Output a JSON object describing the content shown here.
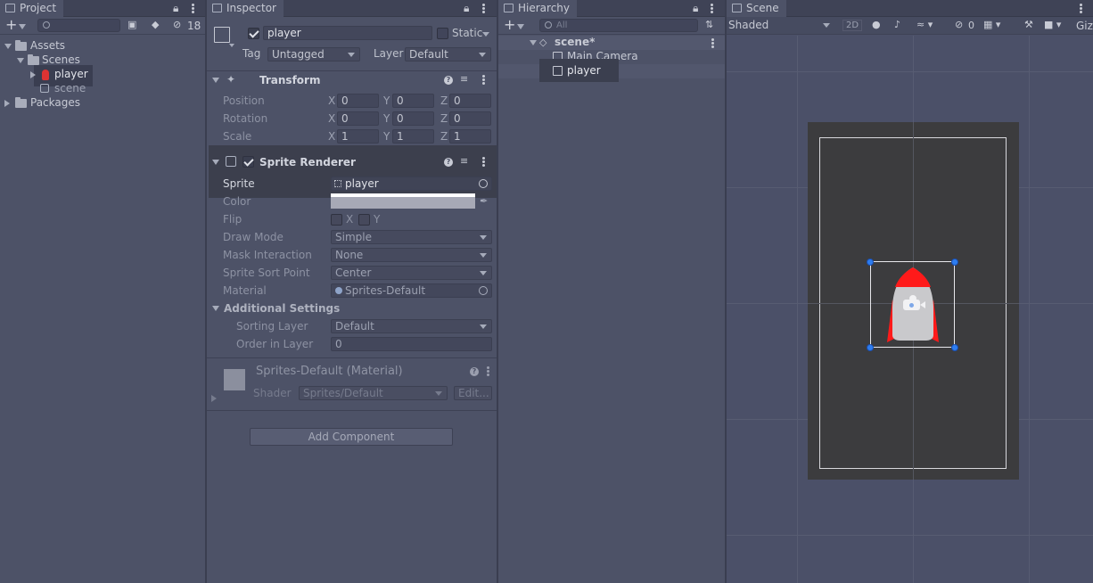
{
  "project": {
    "tab_label": "Project",
    "hidden_count": "18",
    "tree": {
      "assets": "Assets",
      "scenes": "Scenes",
      "player": "player",
      "scene": "scene",
      "packages": "Packages"
    }
  },
  "inspector": {
    "tab_label": "Inspector",
    "object_name": "player",
    "static_label": "Static",
    "tag_label": "Tag",
    "tag_value": "Untagged",
    "layer_label": "Layer",
    "layer_value": "Default",
    "transform": {
      "title": "Transform",
      "position_label": "Position",
      "rotation_label": "Rotation",
      "scale_label": "Scale",
      "position": {
        "x": "0",
        "y": "0",
        "z": "0"
      },
      "rotation": {
        "x": "0",
        "y": "0",
        "z": "0"
      },
      "scale": {
        "x": "1",
        "y": "1",
        "z": "1"
      },
      "axis_x": "X",
      "axis_y": "Y",
      "axis_z": "Z"
    },
    "sprite_renderer": {
      "title": "Sprite Renderer",
      "sprite_label": "Sprite",
      "sprite_value": "player",
      "color_label": "Color",
      "flip_label": "Flip",
      "flip_x": "X",
      "flip_y": "Y",
      "draw_mode_label": "Draw Mode",
      "draw_mode_value": "Simple",
      "mask_label": "Mask Interaction",
      "mask_value": "None",
      "sort_point_label": "Sprite Sort Point",
      "sort_point_value": "Center",
      "material_label": "Material",
      "material_value": "Sprites-Default",
      "additional_label": "Additional Settings",
      "sorting_layer_label": "Sorting Layer",
      "sorting_layer_value": "Default",
      "order_label": "Order in Layer",
      "order_value": "0"
    },
    "material": {
      "title": "Sprites-Default (Material)",
      "shader_label": "Shader",
      "shader_value": "Sprites/Default",
      "edit_label": "Edit..."
    },
    "add_component": "Add Component"
  },
  "hierarchy": {
    "tab_label": "Hierarchy",
    "search_placeholder": "All",
    "scene_name": "scene*",
    "items": [
      "Main Camera",
      "player"
    ]
  },
  "scene": {
    "tab_label": "Scene",
    "shading_mode": "Shaded",
    "mode_2d": "2D",
    "hidden_count": "0",
    "gizmos_label": "Giz"
  },
  "colors": {
    "panel_bg": "#4d5267",
    "scene_bg": "#4b5068",
    "camera_rect": "#3b3b3d",
    "rocket_red": "#ff1a1a",
    "rocket_body": "#c9c9cc",
    "handle_blue": "#2d7df0"
  }
}
